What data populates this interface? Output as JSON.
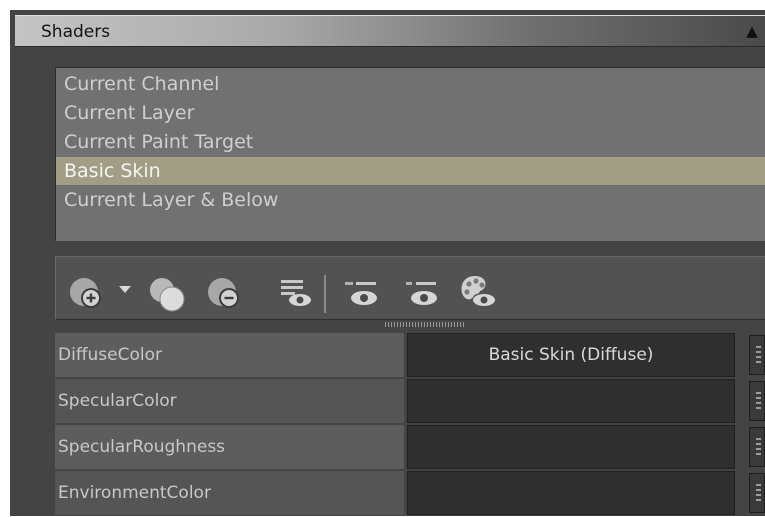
{
  "panel": {
    "title": "Shaders",
    "collapse_glyph": "▲"
  },
  "list": {
    "items": [
      {
        "label": "Current Channel"
      },
      {
        "label": "Current Layer"
      },
      {
        "label": "Current Paint Target"
      },
      {
        "label": "Basic Skin"
      },
      {
        "label": "Current Layer & Below"
      }
    ],
    "selected_index": 3
  },
  "toolbar": {
    "icons": [
      "add-shader-icon",
      "dropdown-arrow-icon",
      "duplicate-shader-icon",
      "remove-shader-icon",
      "show-layers-icon",
      "show-channel-icon",
      "show-target-icon",
      "palette-view-icon"
    ]
  },
  "properties": {
    "rows": [
      {
        "name": "DiffuseColor",
        "value": "Basic Skin (Diffuse)"
      },
      {
        "name": "SpecularColor",
        "value": ""
      },
      {
        "name": "SpecularRoughness",
        "value": ""
      },
      {
        "name": "EnvironmentColor",
        "value": ""
      }
    ]
  },
  "colors": {
    "panel_bg": "#444444",
    "list_bg": "#717171",
    "selection": "#a29e85",
    "value_cell": "#2f2f2f"
  }
}
